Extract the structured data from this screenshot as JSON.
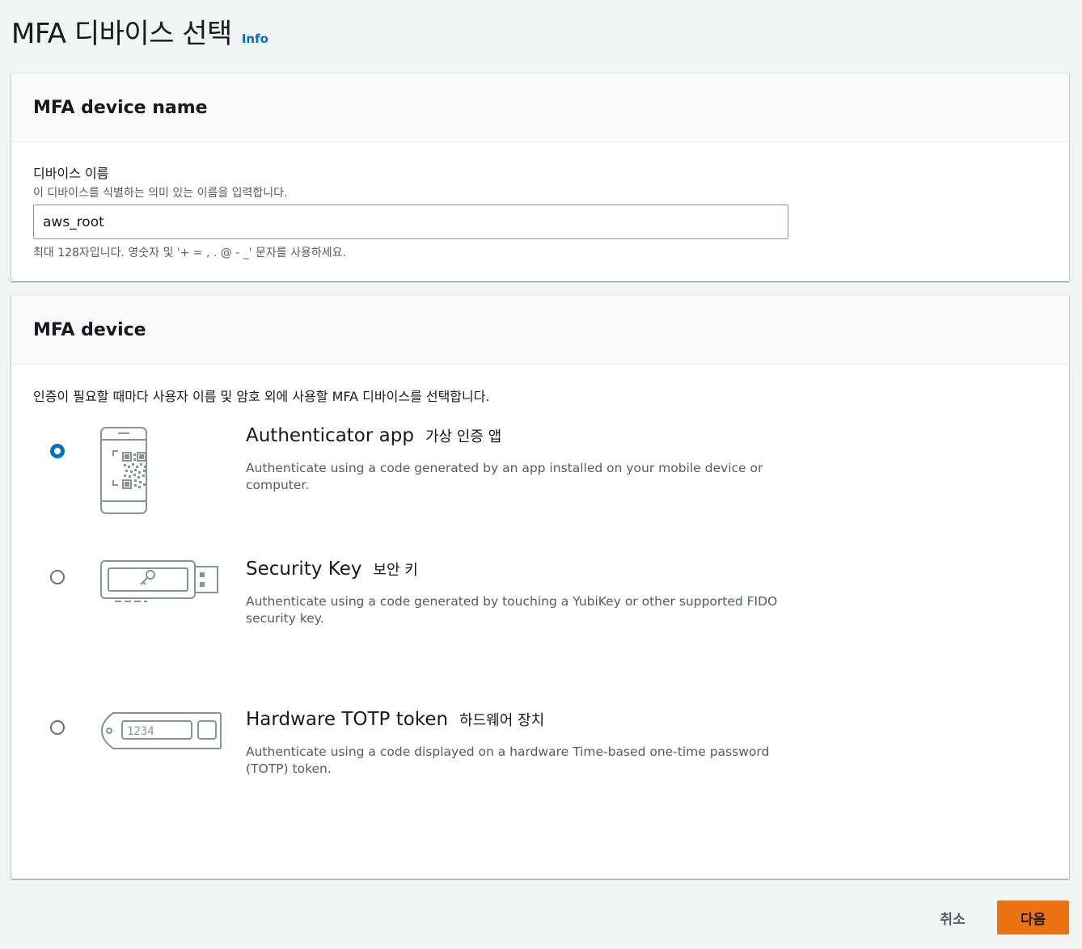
{
  "header": {
    "title": "MFA 디바이스 선택",
    "info_link": "Info"
  },
  "device_name_panel": {
    "title": "MFA device name",
    "field_label": "디바이스 이름",
    "field_description": "이 디바이스를 식별하는 의미 있는 이름을 입력합니다.",
    "input_value": "aws_root",
    "field_hint": "최대 128자입니다. 영숫자 및 '+ = , . @ - _' 문자를 사용하세요."
  },
  "device_panel": {
    "title": "MFA device",
    "description": "인증이 필요할 때마다 사용자 이름 및 암호 외에 사용할 MFA 디바이스를 선택합니다.",
    "options": [
      {
        "title": "Authenticator app",
        "title_ko": "가상 인증 앱",
        "description": "Authenticate using a code generated by an app installed on your mobile device or computer.",
        "selected": true,
        "icon": "phone-qr-icon"
      },
      {
        "title": "Security Key",
        "title_ko": "보안 키",
        "description": "Authenticate using a code generated by touching a YubiKey or other supported FIDO security key.",
        "selected": false,
        "icon": "usb-key-icon"
      },
      {
        "title": "Hardware TOTP token",
        "title_ko": "하드웨어 장치",
        "description": "Authenticate using a code displayed on a hardware Time-based one-time password (TOTP) token.",
        "selected": false,
        "icon": "totp-token-icon",
        "token_digits": "1234"
      }
    ]
  },
  "footer": {
    "cancel_label": "취소",
    "next_label": "다음"
  },
  "colors": {
    "accent": "#0073bb",
    "primary_button": "#ec7211",
    "background": "#f2f3f3"
  }
}
